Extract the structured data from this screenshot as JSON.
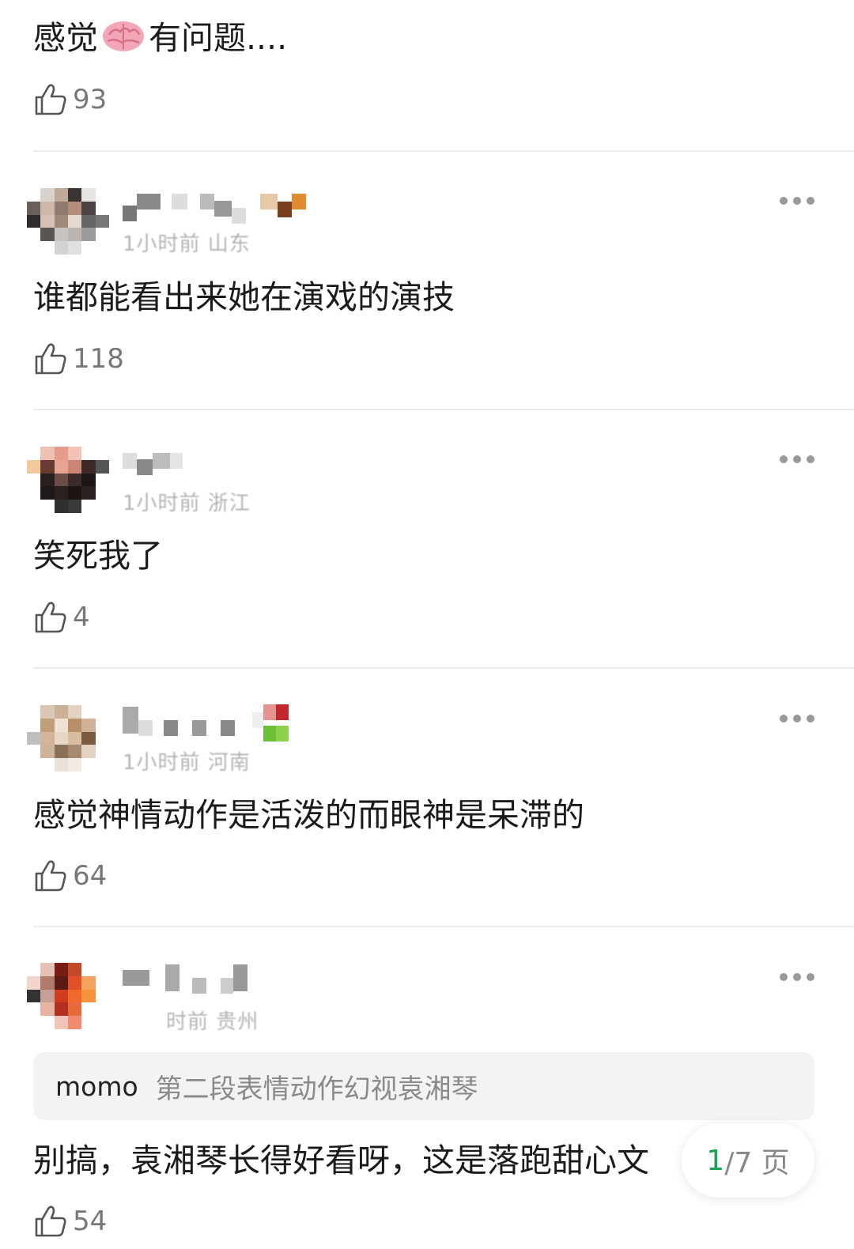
{
  "colors": {
    "accent_green": "#1aa352",
    "divider": "#ececec",
    "muted_text": "#888888",
    "quote_bg": "#f3f3f3"
  },
  "comments": [
    {
      "text_before_emoji": "感觉",
      "emoji": "brain-emoji",
      "text_after_emoji": "有问题....",
      "likes": "93"
    },
    {
      "meta": "1小时前 山东",
      "text": "谁都能看出来她在演戏的演技",
      "likes": "118"
    },
    {
      "meta": "1小时前 浙江",
      "text": "笑死我了",
      "likes": "4"
    },
    {
      "meta": "1小时前 河南",
      "text": "感觉神情动作是活泼的而眼神是呆滞的",
      "likes": "64"
    },
    {
      "meta": "时前 贵州",
      "quote_name": "momo",
      "quote_text": "第二段表情动作幻视袁湘琴",
      "text": "别搞，袁湘琴长得好看呀，这是落跑甜心文",
      "likes": "54"
    }
  ],
  "pager": {
    "current": "1",
    "separator_total": "/7 页"
  },
  "icons": {
    "like": "thumbs-up-icon",
    "more": "more-dots-icon"
  }
}
